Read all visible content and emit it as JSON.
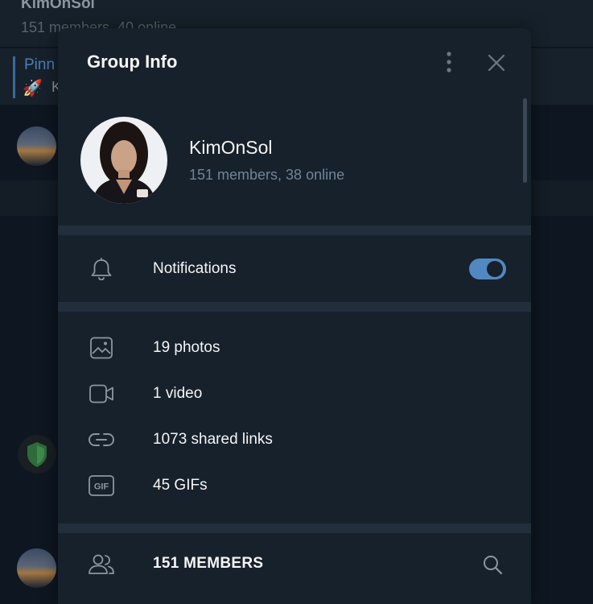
{
  "background": {
    "chat_title": "KimOnSol",
    "chat_subtitle": "151 members, 40 online",
    "pinned_label": "Pinn",
    "pinned_text": "K"
  },
  "modal": {
    "title": "Group Info",
    "more_icon": "more-vertical-icon",
    "close_icon": "close-icon"
  },
  "profile": {
    "name": "KimOnSol",
    "status": "151 members, 38 online"
  },
  "notifications": {
    "label": "Notifications",
    "enabled": true,
    "icon": "bell-icon"
  },
  "media": [
    {
      "label": "19 photos",
      "icon": "photo-icon"
    },
    {
      "label": "1 video",
      "icon": "video-icon"
    },
    {
      "label": "1073 shared links",
      "icon": "link-icon"
    },
    {
      "label": "45 GIFs",
      "icon": "gif-icon"
    }
  ],
  "members": {
    "label": "151 MEMBERS",
    "icon": "members-icon",
    "search_icon": "search-icon"
  },
  "colors": {
    "accent": "#5288c1",
    "panel": "#17212b",
    "muted_text": "#708499"
  }
}
